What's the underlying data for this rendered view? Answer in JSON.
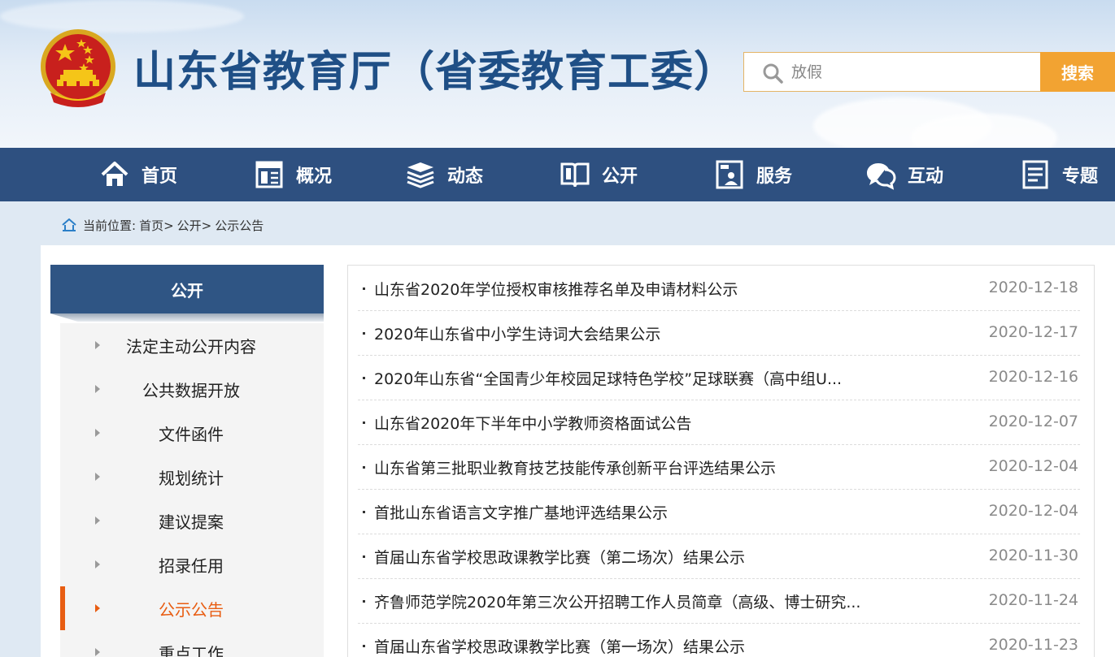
{
  "header": {
    "site_title": "山东省教育厅（省委教育工委）",
    "search_placeholder": "放假",
    "search_button": "搜索",
    "emblem_icon": "national-emblem-icon"
  },
  "nav": {
    "items": [
      {
        "label": "首页",
        "icon": "home-icon"
      },
      {
        "label": "概况",
        "icon": "overview-icon"
      },
      {
        "label": "动态",
        "icon": "stack-icon"
      },
      {
        "label": "公开",
        "icon": "open-book-icon"
      },
      {
        "label": "服务",
        "icon": "service-icon"
      },
      {
        "label": "互动",
        "icon": "chat-icon"
      },
      {
        "label": "专题",
        "icon": "document-icon"
      }
    ]
  },
  "breadcrumb": {
    "prefix": "当前位置:",
    "items": [
      "首页>",
      "公开>",
      "公示公告"
    ]
  },
  "sidebar": {
    "heading": "公开",
    "items": [
      {
        "label": "法定主动公开内容",
        "active": false
      },
      {
        "label": "公共数据开放",
        "active": false
      },
      {
        "label": "文件函件",
        "active": false
      },
      {
        "label": "规划统计",
        "active": false
      },
      {
        "label": "建议提案",
        "active": false
      },
      {
        "label": "招录任用",
        "active": false
      },
      {
        "label": "公示公告",
        "active": true
      },
      {
        "label": "重点工作",
        "active": false
      }
    ]
  },
  "news": {
    "items": [
      {
        "title": "山东省2020年学位授权审核推荐名单及申请材料公示",
        "date": "2020-12-18"
      },
      {
        "title": "2020年山东省中小学生诗词大会结果公示",
        "date": "2020-12-17"
      },
      {
        "title": "2020年山东省“全国青少年校园足球特色学校”足球联赛（高中组U...",
        "date": "2020-12-16"
      },
      {
        "title": "山东省2020年下半年中小学教师资格面试公告",
        "date": "2020-12-07"
      },
      {
        "title": "山东省第三批职业教育技艺技能传承创新平台评选结果公示",
        "date": "2020-12-04"
      },
      {
        "title": "首批山东省语言文字推广基地评选结果公示",
        "date": "2020-12-04"
      },
      {
        "title": "首届山东省学校思政课教学比赛（第二场次）结果公示",
        "date": "2020-11-30"
      },
      {
        "title": "齐鲁师范学院2020年第三次公开招聘工作人员简章（高级、博士研究...",
        "date": "2020-11-24"
      },
      {
        "title": "首届山东省学校思政课教学比赛（第一场次）结果公示",
        "date": "2020-11-23"
      }
    ]
  },
  "colors": {
    "nav_bg": "#2e5080",
    "title_blue": "#1f4f86",
    "search_btn": "#f2a332",
    "active_orange": "#e85d12"
  }
}
